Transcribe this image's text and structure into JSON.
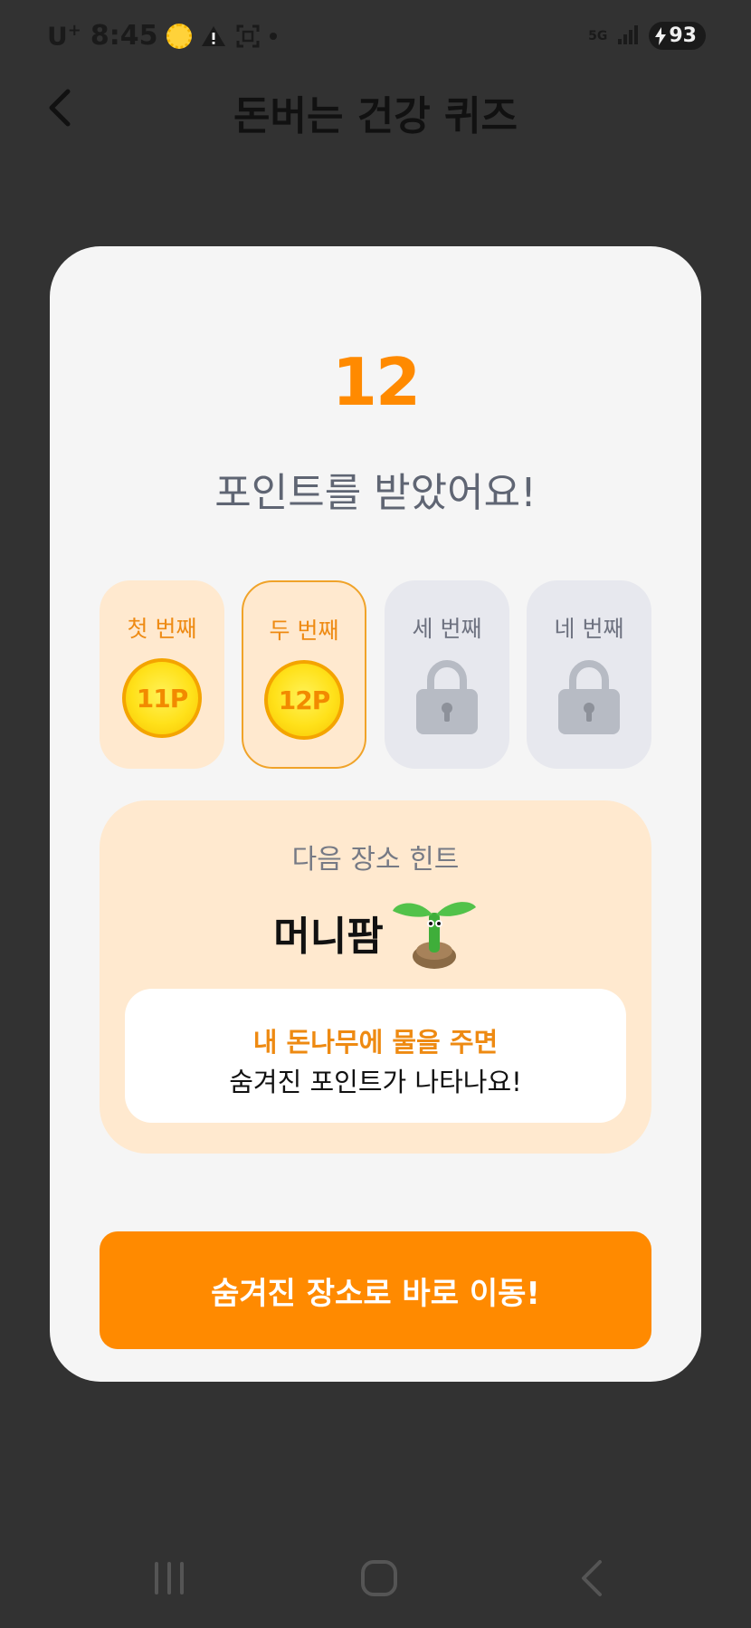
{
  "status_bar": {
    "carrier": "U",
    "carrier_sup": "+",
    "time": "8:45",
    "network": "5G",
    "battery": "93"
  },
  "header": {
    "title": "돈버는 건강 퀴즈"
  },
  "modal": {
    "points": "12",
    "message": "포인트를 받았어요!",
    "rounds": [
      {
        "label": "첫 번째",
        "state": "done",
        "value": "11P"
      },
      {
        "label": "두 번째",
        "state": "current",
        "value": "12P"
      },
      {
        "label": "세 번째",
        "state": "locked"
      },
      {
        "label": "네 번째",
        "state": "locked"
      }
    ],
    "hint": {
      "title": "다음 장소 힌트",
      "place": "머니팜",
      "line1": "내 돈나무에 물을 주면",
      "line2": "숨겨진 포인트가 나타나요!"
    },
    "cta_label": "숨겨진 장소로 바로 이동!"
  },
  "colors": {
    "accent": "#ff8a00",
    "hint_background": "#ffe9cf",
    "locked_background": "#e7e8ee",
    "page_background": "#323232"
  }
}
